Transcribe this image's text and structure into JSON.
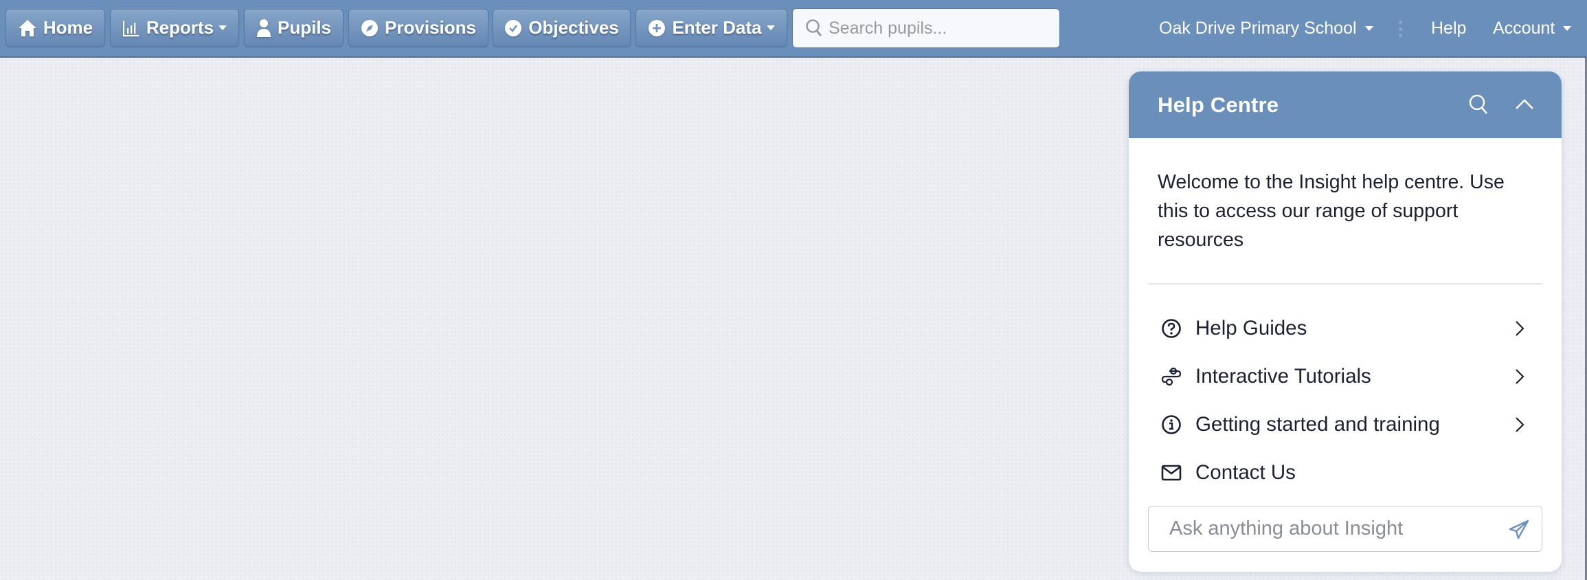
{
  "navbar": {
    "buttons": [
      {
        "label": "Home",
        "icon": "home-icon",
        "dropdown": false
      },
      {
        "label": "Reports",
        "icon": "bar-chart-icon",
        "dropdown": true
      },
      {
        "label": "Pupils",
        "icon": "user-icon",
        "dropdown": false
      },
      {
        "label": "Provisions",
        "icon": "compass-icon",
        "dropdown": false
      },
      {
        "label": "Objectives",
        "icon": "check-circle-icon",
        "dropdown": false
      },
      {
        "label": "Enter Data",
        "icon": "plus-circle-icon",
        "dropdown": true
      }
    ],
    "search": {
      "placeholder": "Search pupils...",
      "value": ""
    },
    "school": "Oak Drive Primary School",
    "help": "Help",
    "account": "Account",
    "colors": {
      "bar": "#6b8fbb",
      "button_top": "#87a5c9",
      "button_bottom": "#6487b4"
    }
  },
  "help_centre": {
    "title": "Help Centre",
    "welcome": "Welcome to the Insight help centre. Use this to access our range of support resources",
    "items": [
      {
        "label": "Help Guides",
        "icon": "question-circle-icon",
        "has_chevron": true
      },
      {
        "label": "Interactive Tutorials",
        "icon": "route-icon",
        "has_chevron": true
      },
      {
        "label": "Getting started and training",
        "icon": "info-circle-icon",
        "has_chevron": true
      },
      {
        "label": "Contact Us",
        "icon": "envelope-icon",
        "has_chevron": false
      }
    ],
    "chat": {
      "placeholder": "Ask anything about Insight",
      "value": ""
    },
    "colors": {
      "header": "#6a8fbb",
      "text": "#1c2033",
      "send_icon": "#6a8fbb"
    }
  }
}
